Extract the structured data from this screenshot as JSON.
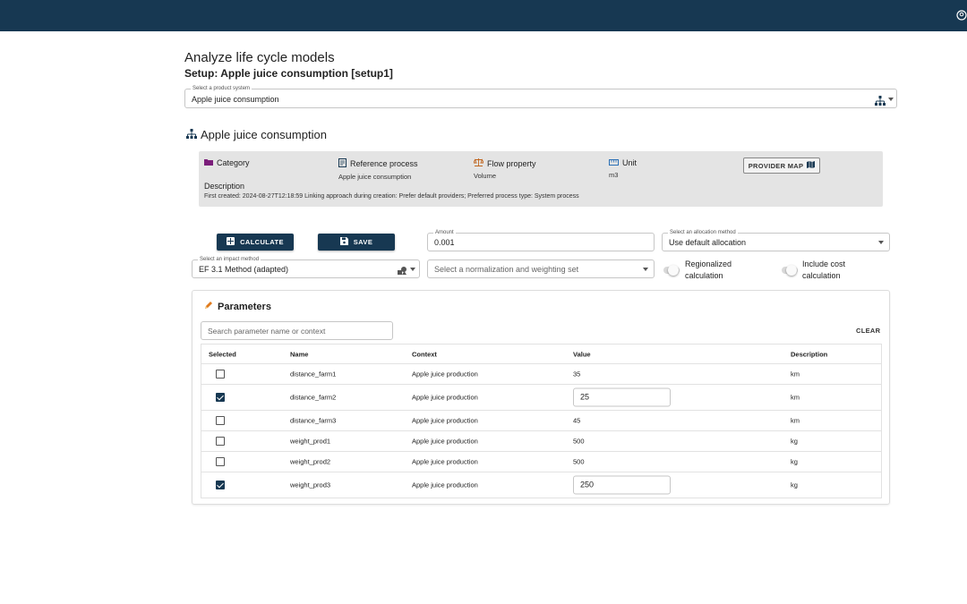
{
  "header": {
    "user_icon": "account-circle-icon"
  },
  "page": {
    "title": "Analyze life cycle models",
    "setup_title": "Setup: Apple juice consumption [setup1]"
  },
  "product_system": {
    "label": "Select a product system",
    "value": "Apple juice consumption"
  },
  "section": {
    "title": "Apple juice consumption"
  },
  "info": {
    "category_label": "Category",
    "reference_process_label": "Reference process",
    "reference_process_value": "Apple juice consumption",
    "flow_property_label": "Flow property",
    "flow_property_value": "Volume",
    "unit_label": "Unit",
    "unit_value": "m3",
    "provider_map_label": "PROVIDER MAP",
    "description_label": "Description",
    "description_text": "First created: 2024-08-27T12:18:59 Linking approach during creation: Prefer default providers; Preferred process type: System process"
  },
  "actions": {
    "calculate_label": "CALCULATE",
    "save_label": "SAVE"
  },
  "amount": {
    "label": "Amount",
    "value": "0.001"
  },
  "allocation": {
    "label": "Select an allocation method",
    "value": "Use default allocation"
  },
  "impact": {
    "label": "Select an impact method",
    "value": "EF 3.1 Method (adapted)"
  },
  "normalization": {
    "placeholder": "Select a normalization and weighting set"
  },
  "toggles": {
    "regionalized_line1": "Regionalized",
    "regionalized_line2": "calculation",
    "cost_line1": "Include cost",
    "cost_line2": "calculation"
  },
  "parameters": {
    "title": "Parameters",
    "search_placeholder": "Search parameter name or context",
    "clear_label": "CLEAR",
    "columns": {
      "selected": "Selected",
      "name": "Name",
      "context": "Context",
      "value": "Value",
      "description": "Description"
    },
    "rows": [
      {
        "selected": false,
        "name": "distance_farm1",
        "context": "Apple juice production",
        "value": "35",
        "description": "km"
      },
      {
        "selected": true,
        "name": "distance_farm2",
        "context": "Apple juice production",
        "value": "25",
        "description": "km"
      },
      {
        "selected": false,
        "name": "distance_farm3",
        "context": "Apple juice production",
        "value": "45",
        "description": "km"
      },
      {
        "selected": false,
        "name": "weight_prod1",
        "context": "Apple juice production",
        "value": "500",
        "description": "kg"
      },
      {
        "selected": false,
        "name": "weight_prod2",
        "context": "Apple juice production",
        "value": "500",
        "description": "kg"
      },
      {
        "selected": true,
        "name": "weight_prod3",
        "context": "Apple juice production",
        "value": "250",
        "description": "kg"
      }
    ]
  },
  "colors": {
    "brand": "#173852",
    "category_icon": "#7b1e7a",
    "pencil_icon": "#e07b1e"
  }
}
